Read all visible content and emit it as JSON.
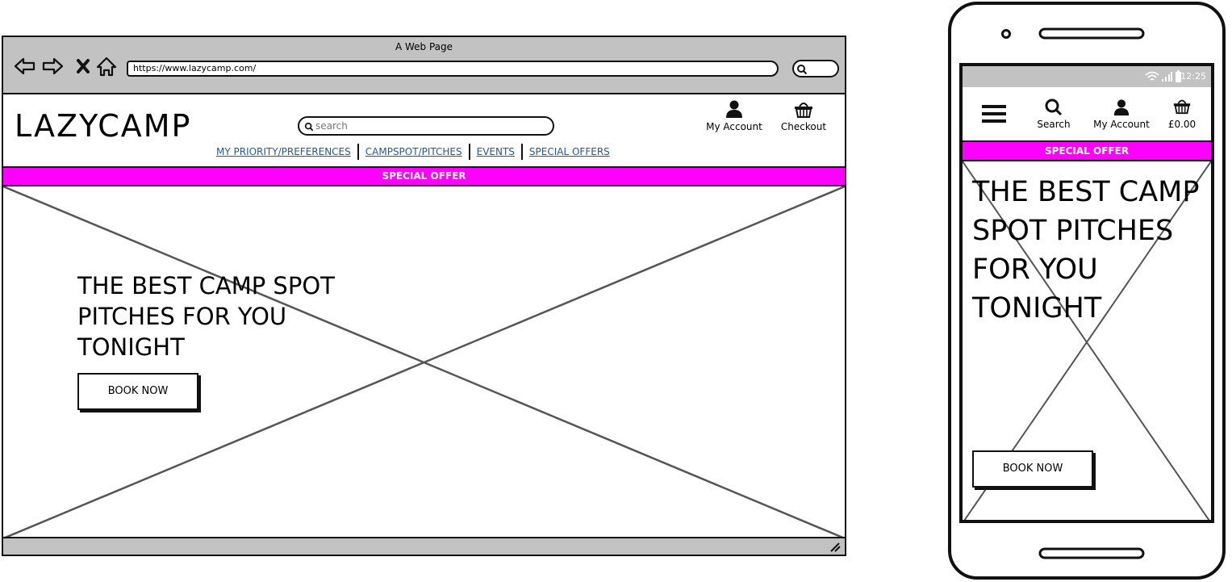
{
  "desktop": {
    "window_title": "A Web Page",
    "url": "https://www.lazycamp.com/",
    "logo": "LAZYCAMP",
    "search_placeholder": "search",
    "account_label": "My Account",
    "checkout_label": "Checkout",
    "nav": [
      {
        "label": "MY PRIORITY/PREFERENCES"
      },
      {
        "label": "CAMPSPOT/PITCHES"
      },
      {
        "label": "EVENTS"
      },
      {
        "label": "SPECIAL OFFERS"
      }
    ],
    "offer": "SPECIAL OFFER",
    "hero_title": "THE BEST CAMP SPOT PITCHES FOR YOU TONIGHT",
    "book_button": "BOOK NOW"
  },
  "mobile": {
    "time": "12:25",
    "search_label": "Search",
    "account_label": "My Account",
    "basket_total": "£0.00",
    "offer": "SPECIAL OFFER",
    "hero_title": "THE BEST CAMP SPOT PITCHES FOR YOU TONIGHT",
    "book_button": "BOOK NOW"
  },
  "colors": {
    "offer_bar": "#ff00ff",
    "chrome": "#c2c2c2",
    "link": "#1d5a9a"
  },
  "icons": [
    "back-arrow-icon",
    "forward-arrow-icon",
    "stop-icon",
    "home-icon",
    "search-icon",
    "user-icon",
    "basket-icon",
    "hamburger-icon",
    "wifi-icon",
    "signal-icon",
    "battery-icon",
    "resize-grip-icon"
  ]
}
